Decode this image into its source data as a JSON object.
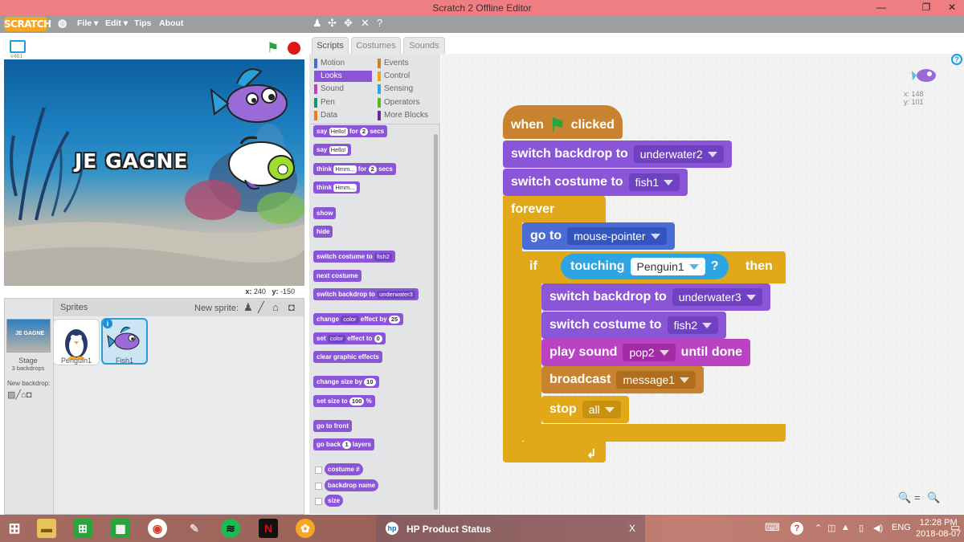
{
  "window": {
    "title": "Scratch 2 Offline Editor",
    "minimize": "—",
    "maximize": "❐",
    "close": "✕"
  },
  "menu": {
    "logo": "SCRATCH",
    "file": "File ▾",
    "edit": "Edit ▾",
    "tips": "Tips",
    "about": "About"
  },
  "stage": {
    "version": "v461",
    "text": "JE GAGNE",
    "x_label": "x:",
    "x_value": "240",
    "y_label": "y:",
    "y_value": "-150"
  },
  "sprites_pane": {
    "title": "Sprites",
    "new_sprite": "New sprite:",
    "stage_name": "Stage",
    "stage_backdrops": "3 backdrops",
    "new_backdrop": "New backdrop:",
    "sprites": [
      {
        "name": "Penguin1"
      },
      {
        "name": "Fish1"
      }
    ]
  },
  "tabs": [
    "Scripts",
    "Costumes",
    "Sounds"
  ],
  "categories": {
    "left": [
      {
        "label": "Motion",
        "color": "#4a6cd4"
      },
      {
        "label": "Looks",
        "color": "#8a55d7"
      },
      {
        "label": "Sound",
        "color": "#bb42c3"
      },
      {
        "label": "Pen",
        "color": "#0e9a6c"
      },
      {
        "label": "Data",
        "color": "#ee7d16"
      }
    ],
    "right": [
      {
        "label": "Events",
        "color": "#c88330"
      },
      {
        "label": "Control",
        "color": "#e1a91a"
      },
      {
        "label": "Sensing",
        "color": "#2ca5e2"
      },
      {
        "label": "Operators",
        "color": "#5cb712"
      },
      {
        "label": "More Blocks",
        "color": "#632d99"
      }
    ]
  },
  "palette": {
    "say_for": {
      "say": "say",
      "text": "Hello!",
      "for": "for",
      "num": "2",
      "secs": "secs"
    },
    "say": {
      "say": "say",
      "text": "Hello!"
    },
    "think_for": {
      "think": "think",
      "text": "Hmm...",
      "for": "for",
      "num": "2",
      "secs": "secs"
    },
    "think": {
      "think": "think",
      "text": "Hmm..."
    },
    "show": "show",
    "hide": "hide",
    "switch_costume": {
      "label": "switch costume to",
      "value": "fish2"
    },
    "next_costume": "next costume",
    "switch_backdrop": {
      "label": "switch backdrop to",
      "value": "underwater3"
    },
    "change_effect": {
      "change": "change",
      "effect": "color",
      "by": "effect by",
      "num": "25"
    },
    "set_effect": {
      "set": "set",
      "effect": "color",
      "to": "effect to",
      "num": "0"
    },
    "clear_effects": "clear graphic effects",
    "change_size": {
      "label": "change size by",
      "num": "10"
    },
    "set_size": {
      "label": "set size to",
      "num": "100",
      "unit": "%"
    },
    "go_front": "go to front",
    "go_back": {
      "label": "go back",
      "num": "1",
      "layers": "layers"
    },
    "costume_num": "costume #",
    "backdrop_name": "backdrop name",
    "size": "size"
  },
  "script": {
    "hat": {
      "when": "when",
      "clicked": "clicked"
    },
    "switch_backdrop_1": {
      "label": "switch backdrop to",
      "value": "underwater2"
    },
    "switch_costume_1": {
      "label": "switch costume to",
      "value": "fish1"
    },
    "forever": "forever",
    "go_to": {
      "label": "go to",
      "value": "mouse-pointer"
    },
    "if": {
      "if": "if",
      "touching": "touching",
      "value": "Penguin1",
      "q": "?",
      "then": "then"
    },
    "switch_backdrop_2": {
      "label": "switch backdrop to",
      "value": "underwater3"
    },
    "switch_costume_2": {
      "label": "switch costume to",
      "value": "fish2"
    },
    "play_sound": {
      "label": "play sound",
      "value": "pop2",
      "until": "until done"
    },
    "broadcast": {
      "label": "broadcast",
      "value": "message1"
    },
    "stop": {
      "label": "stop",
      "value": "all"
    },
    "sprite_x": "x: 148",
    "sprite_y": "y: 101",
    "zoom_out": "🔍",
    "zoom_reset": "=",
    "zoom_in": "🔍"
  },
  "taskbar": {
    "hp_label": "HP Product Status",
    "hp_close": "X",
    "lang": "ENG",
    "time": "12:28 PM",
    "date": "2018-08-07"
  }
}
